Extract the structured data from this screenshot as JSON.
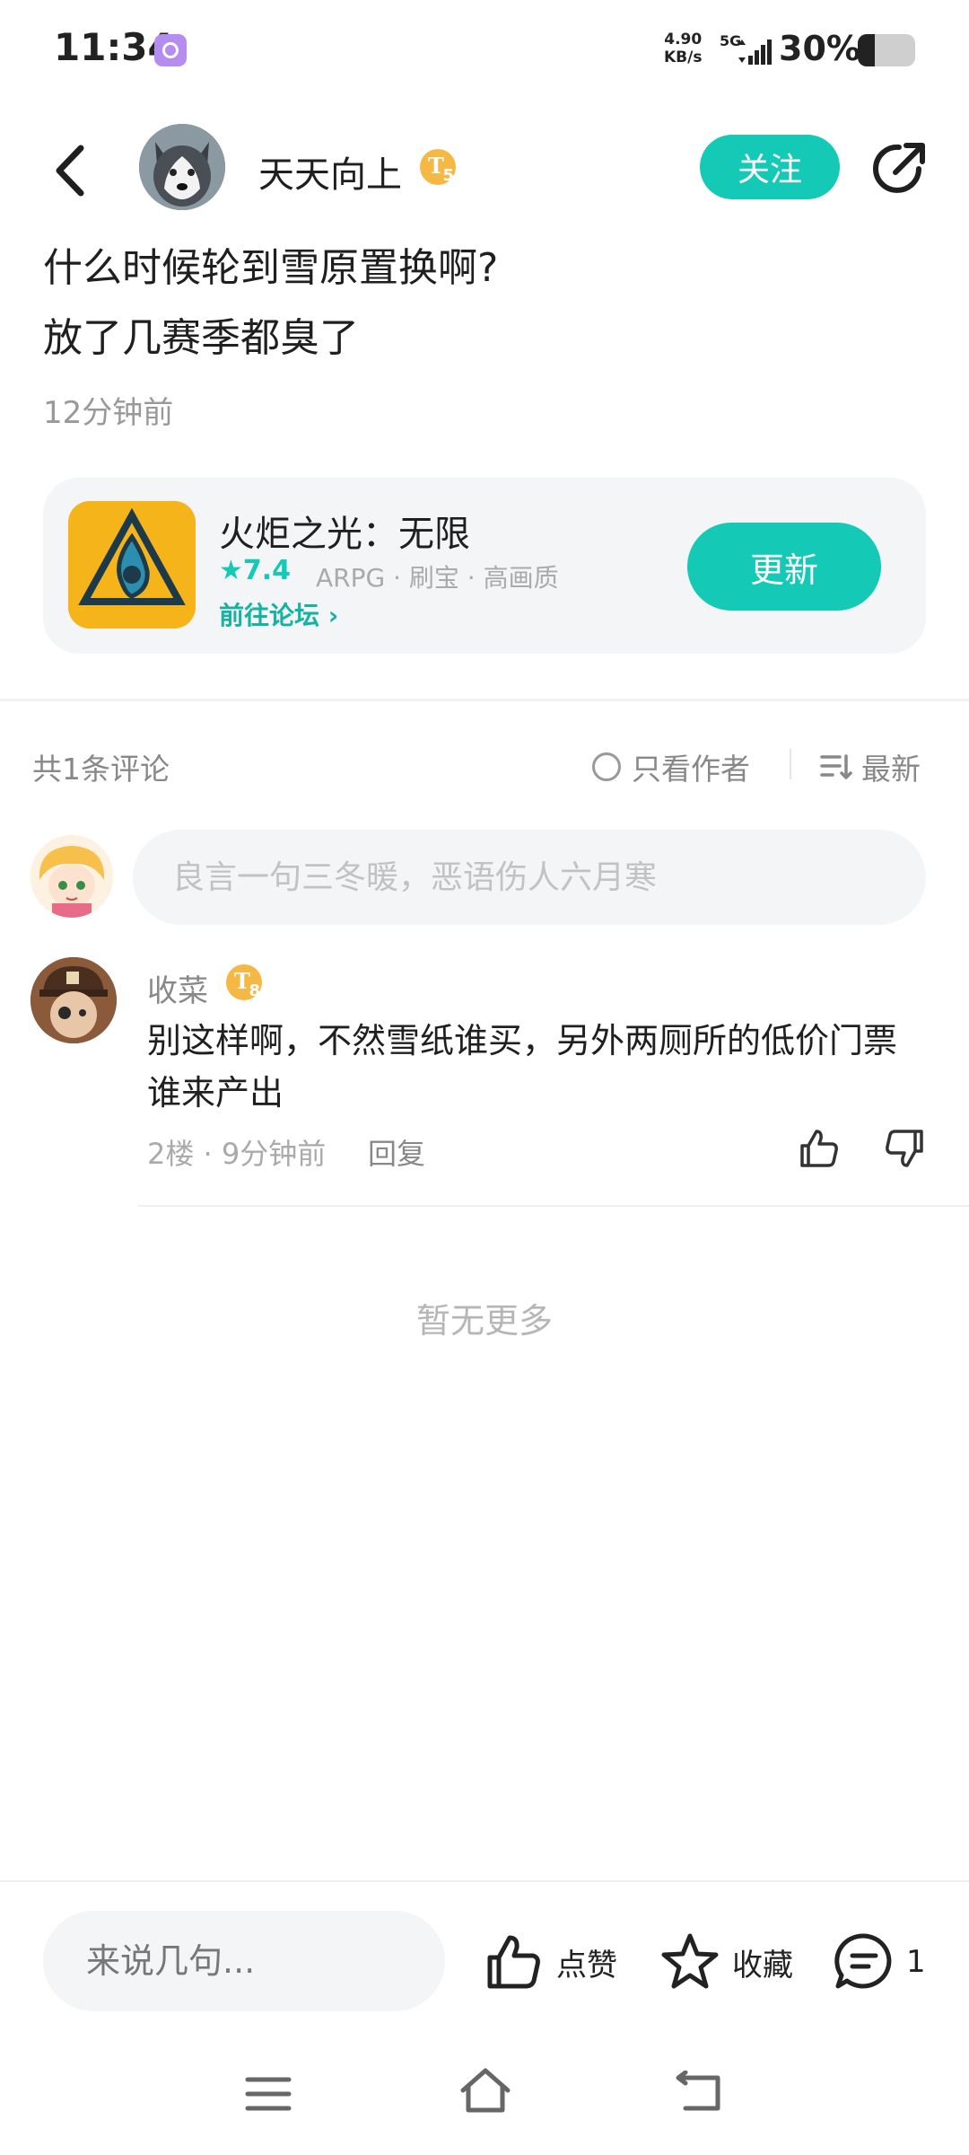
{
  "status_bar": {
    "time": "11:34",
    "net_speed_value": "4.90",
    "net_speed_unit": "KB/s",
    "network": "5G",
    "battery_percent": "30%",
    "battery_level": 0.3
  },
  "header": {
    "author_name": "天天向上",
    "author_level": "5",
    "follow_label": "关注"
  },
  "post": {
    "title": "什么时候轮到雪原置换啊?",
    "body": "放了几赛季都臭了",
    "time": "12分钟前"
  },
  "game_card": {
    "name": "火炬之光：无限",
    "rating": "★7.4",
    "tags": "ARPG · 刷宝 · 高画质",
    "forum_link": "前往论坛",
    "update_label": "更新"
  },
  "comments_section": {
    "count_label": "共1条评论",
    "author_only_label": "只看作者",
    "sort_label": "最新",
    "input_placeholder": "良言一句三冬暖，恶语伤人六月寒"
  },
  "comments": [
    {
      "user": "收菜",
      "level": "8",
      "text": "别这样啊，不然雪纸谁买，另外两厕所的低价门票谁来产出",
      "meta": "2楼 · 9分钟前",
      "reply_label": "回复"
    }
  ],
  "no_more_label": "暂无更多",
  "bottom_bar": {
    "input_placeholder": "来说几句...",
    "like_label": "点赞",
    "favorite_label": "收藏",
    "comment_count": "1"
  },
  "colors": {
    "accent": "#14c9b6",
    "badge": "#f5b845"
  }
}
